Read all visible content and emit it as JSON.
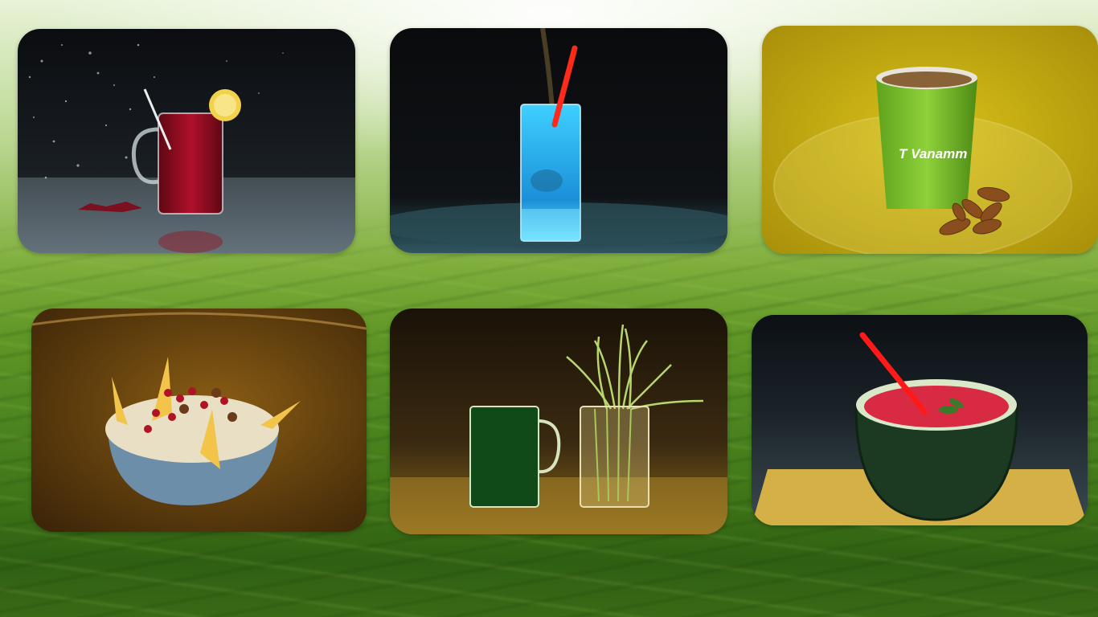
{
  "background": {
    "scene": "tea-plantation",
    "colors": {
      "sky": "#eef6e4",
      "field": "#5f9626",
      "field_dark": "#2f5f12"
    }
  },
  "gallery": {
    "items": [
      {
        "subject": "red-hibiscus-tea-glass"
      },
      {
        "subject": "blue-soda-glass"
      },
      {
        "subject": "cup-with-almonds",
        "cup_text": "T Vanamm"
      },
      {
        "subject": "fruit-oats-bowl"
      },
      {
        "subject": "wheatgrass-juice-glass"
      },
      {
        "subject": "watermelon-juice-bowl"
      }
    ]
  }
}
